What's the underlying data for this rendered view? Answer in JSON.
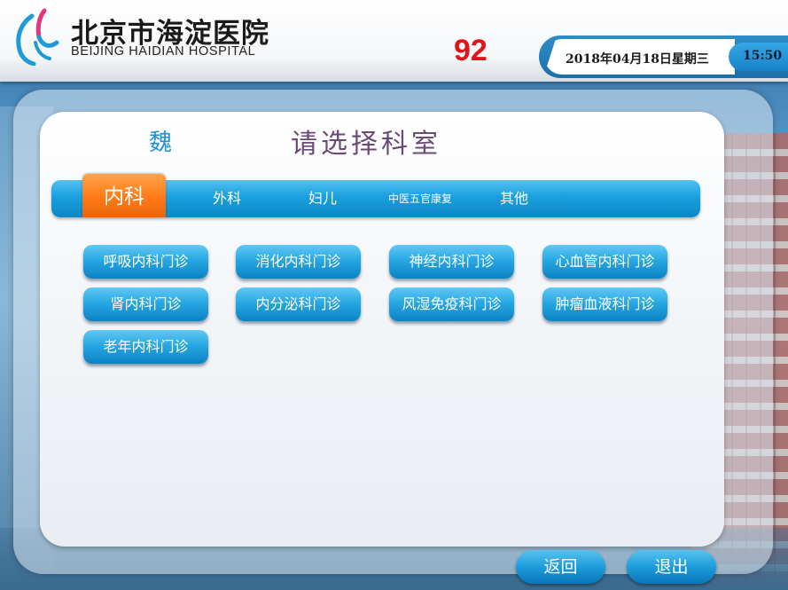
{
  "header": {
    "hospital_name_cn": "北京市海淀医院",
    "hospital_name_en": "BEIJING HAIDIAN HOSPITAL",
    "queue_number": "92",
    "date": "2018年04月18日星期三",
    "time": "15:50"
  },
  "main": {
    "patient_name": "魏",
    "title": "请选择科室",
    "tabs": [
      {
        "label": "内科",
        "active": true
      },
      {
        "label": "外科",
        "active": false
      },
      {
        "label": "妇儿",
        "active": false
      },
      {
        "label": "中医五官康复",
        "active": false
      },
      {
        "label": "其他",
        "active": false
      }
    ],
    "departments": [
      "呼吸内科门诊",
      "消化内科门诊",
      "神经内科门诊",
      "心血管内科门诊",
      "肾内科门诊",
      "内分泌科门诊",
      "风湿免疫科门诊",
      "肿瘤血液科门诊",
      "老年内科门诊"
    ]
  },
  "footer": {
    "back_label": "返回",
    "exit_label": "退出"
  },
  "colors": {
    "accent_blue": "#19a0df",
    "active_tab_orange": "#ff7a16",
    "queue_red": "#e0141a",
    "title_purple": "#6b4b75"
  },
  "icons": {
    "logo": "hospital-logo-icon"
  }
}
